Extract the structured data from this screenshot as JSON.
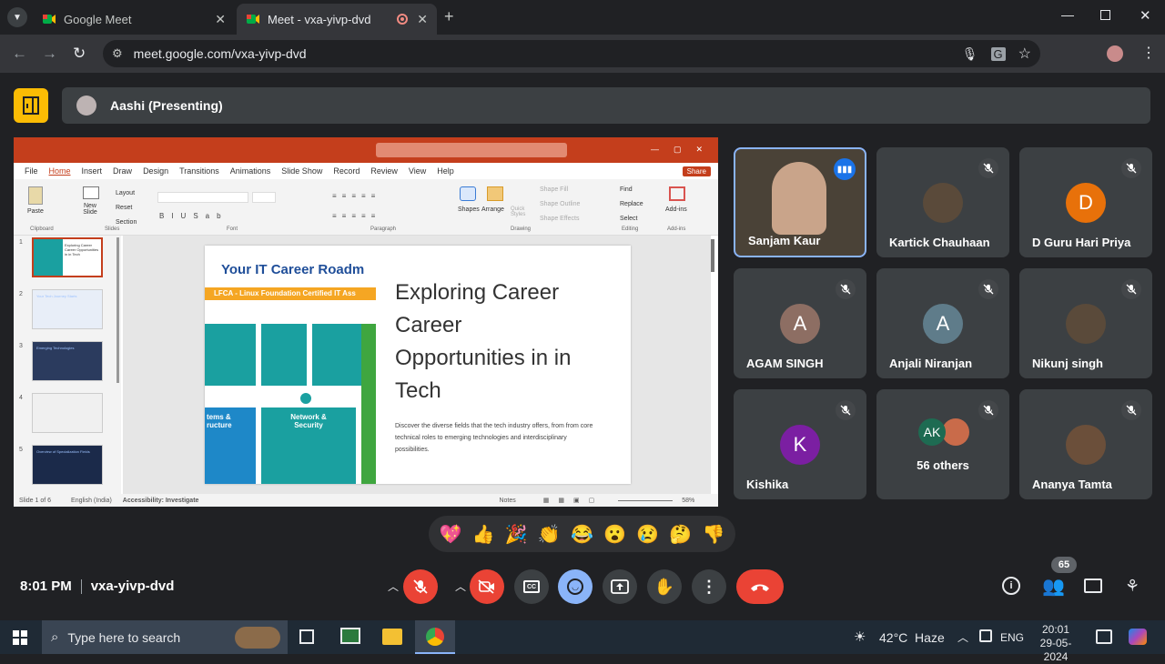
{
  "browser": {
    "tabs": [
      {
        "title": "Google Meet",
        "active": false
      },
      {
        "title": "Meet - vxa-yivp-dvd",
        "active": true
      }
    ],
    "url": "meet.google.com/vxa-yivp-dvd"
  },
  "meet": {
    "presenting_label": "Aashi (Presenting)",
    "time": "8:01 PM",
    "meeting_code": "vxa-yivp-dvd",
    "participant_count": "65",
    "participants": [
      {
        "name": "Sanjam Kaur",
        "initial": "",
        "color": "",
        "speaking": true
      },
      {
        "name": "Kartick Chauhaan",
        "initial": "",
        "color": ""
      },
      {
        "name": "D Guru Hari Priya",
        "initial": "D",
        "color": "#e8710a"
      },
      {
        "name": "AGAM SINGH",
        "initial": "A",
        "color": "#8d6e63"
      },
      {
        "name": "Anjali Niranjan",
        "initial": "A",
        "color": "#5f7c8a"
      },
      {
        "name": "Nikunj singh",
        "initial": "",
        "color": ""
      },
      {
        "name": "Kishika",
        "initial": "K",
        "color": "#7b1fa2"
      },
      {
        "name": "56 others",
        "initial": "AK",
        "color": "#1e6b52"
      },
      {
        "name": "Ananya Tamta",
        "initial": "",
        "color": ""
      }
    ],
    "reactions": [
      "💖",
      "👍",
      "🎉",
      "👏",
      "😂",
      "😮",
      "😢",
      "🤔",
      "👎"
    ]
  },
  "ppt": {
    "tabs": [
      "File",
      "Home",
      "Insert",
      "Draw",
      "Design",
      "Transitions",
      "Animations",
      "Slide Show",
      "Record",
      "Review",
      "View",
      "Help"
    ],
    "share": "Share",
    "groups": [
      "Clipboard",
      "Slides",
      "Font",
      "Paragraph",
      "Drawing",
      "Editing",
      "Add-ins"
    ],
    "buttons": {
      "paste": "Paste",
      "new_slide": "New Slide",
      "layout": "Layout",
      "reset": "Reset",
      "section": "Section",
      "shapes": "Shapes",
      "arrange": "Arrange",
      "quick_styles": "Quick Styles",
      "shape_fill": "Shape Fill",
      "shape_outline": "Shape Outline",
      "shape_effects": "Shape Effects",
      "find": "Find",
      "replace": "Replace",
      "select": "Select",
      "addins": "Add-ins"
    },
    "slide": {
      "title": "Exploring Career Career Opportunities in in Tech",
      "body": "Discover the diverse fields that the tech industry offers, from from core technical roles to emerging technologies and interdisciplinary possibilities.",
      "image_heading": "Your IT Career Roadm",
      "image_sub": "LFCA - Linux Foundation Certified IT Ass",
      "box1": "Network & Security",
      "box2": "tems & ructure"
    },
    "thumb_titles": [
      "Exploring Career Career Opportunities in in Tech",
      "Your Tech Journey Starts",
      "Emerging Technologies",
      "",
      "Overview of Specialization Fields"
    ],
    "status": {
      "slide": "Slide 1 of 6",
      "lang": "English (India)",
      "access": "Accessibility: Investigate",
      "notes": "Notes",
      "zoom": "58%"
    }
  },
  "taskbar": {
    "search_placeholder": "Type here to search",
    "weather": "42°C  Haze",
    "lang": "ENG",
    "time": "20:01",
    "date": "29-05-2024"
  }
}
